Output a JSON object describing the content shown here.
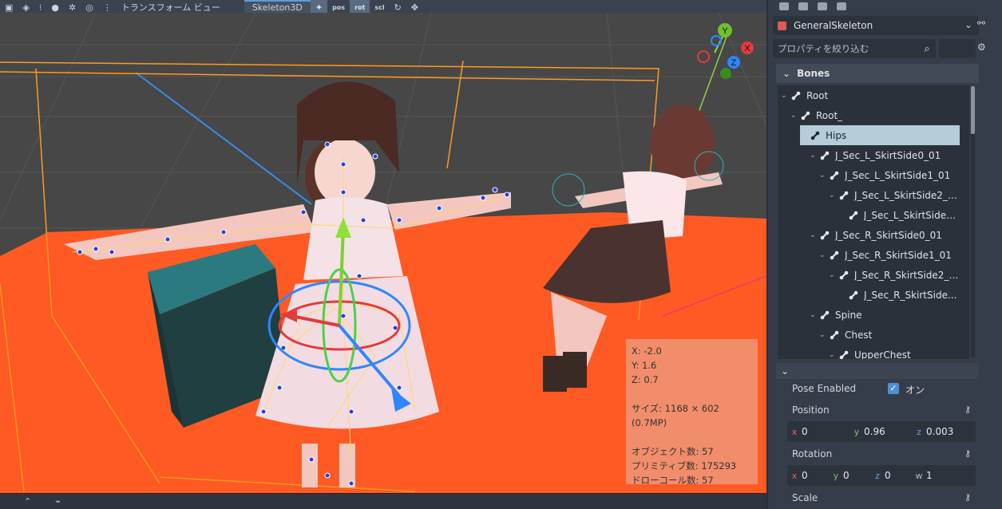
{
  "toolbar": {
    "menu_label": "トランスフォーム ビュー",
    "tab_label": "Skeleton3D",
    "btn_pos": "pos",
    "btn_rot": "rot",
    "btn_scl": "scl"
  },
  "stats": {
    "x": "X: -2.0",
    "y": "Y: 1.6",
    "z": "Z: 0.7",
    "size": "サイズ: 1168 × 602 (0.7MP)",
    "objects": "オブジェクト数: 57",
    "primitives": "プリミティブ数: 175293",
    "drawcalls": "ドローコール数: 57"
  },
  "gizmo": {
    "x": "X",
    "y": "Y",
    "z": "Z"
  },
  "inspector": {
    "node_name": "GeneralSkeleton",
    "filter_placeholder": "プロパティを絞り込む",
    "bones_section": "Bones"
  },
  "bones": [
    {
      "label": "Root",
      "selected": false
    },
    {
      "label": "Root_",
      "selected": false
    },
    {
      "label": "Hips",
      "selected": true
    },
    {
      "label": "J_Sec_L_SkirtSide0_01",
      "selected": false
    },
    {
      "label": "J_Sec_L_SkirtSide1_01",
      "selected": false
    },
    {
      "label": "J_Sec_L_SkirtSide2_01",
      "selected": false
    },
    {
      "label": "J_Sec_L_SkirtSide2...",
      "selected": false
    },
    {
      "label": "J_Sec_R_SkirtSide0_01",
      "selected": false
    },
    {
      "label": "J_Sec_R_SkirtSide1_01",
      "selected": false
    },
    {
      "label": "J_Sec_R_SkirtSide2_01",
      "selected": false
    },
    {
      "label": "J_Sec_R_SkirtSide...",
      "selected": false
    },
    {
      "label": "Spine",
      "selected": false
    },
    {
      "label": "Chest",
      "selected": false
    },
    {
      "label": "UpperChest",
      "selected": false
    }
  ],
  "pose": {
    "enabled_label": "Pose Enabled",
    "enabled_value": "オン",
    "position_label": "Position",
    "position": {
      "x": "0",
      "y": "0.96",
      "z": "0.003"
    },
    "rotation_label": "Rotation",
    "rotation": {
      "x": "0",
      "y": "0",
      "z": "0",
      "w": "1"
    },
    "scale_label": "Scale"
  },
  "colors": {
    "accent": "#4f8fd8",
    "floor": "#ff5a23",
    "selection": "#b4cdd9"
  }
}
